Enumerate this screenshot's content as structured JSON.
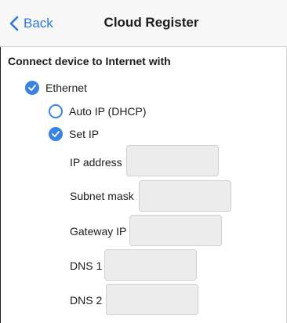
{
  "navbar": {
    "back_label": "Back",
    "title": "Cloud Register"
  },
  "section_title": "Connect device to Internet with",
  "options": {
    "ethernet": {
      "label": "Ethernet",
      "checked": true
    },
    "auto_ip": {
      "label": "Auto IP (DHCP)",
      "checked": false
    },
    "set_ip": {
      "label": "Set IP",
      "checked": true
    }
  },
  "fields": {
    "ip_address": {
      "label": "IP address",
      "value": ""
    },
    "subnet_mask": {
      "label": "Subnet mask",
      "value": ""
    },
    "gateway_ip": {
      "label": "Gateway IP",
      "value": ""
    },
    "dns1": {
      "label": "DNS 1",
      "value": ""
    },
    "dns2": {
      "label": "DNS 2",
      "value": ""
    }
  },
  "colors": {
    "accent": "#3b83e3",
    "back_link": "#2f78d8",
    "navbar_bg": "#f7f7f7",
    "input_bg": "#ececec"
  }
}
